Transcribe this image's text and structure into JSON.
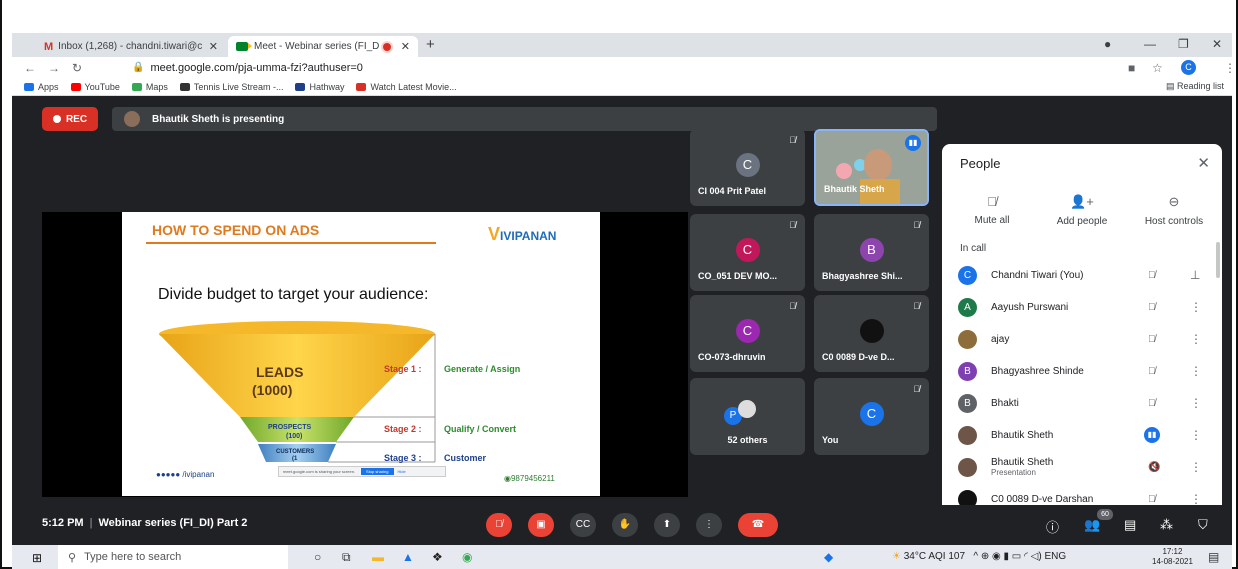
{
  "browser": {
    "tabs": [
      {
        "label": "Inbox (1,268) - chandni.tiwari@c"
      },
      {
        "label": "Meet - Webinar series (FI_D"
      }
    ],
    "url": "meet.google.com/pja-umma-fzi?authuser=0",
    "profile_initial": "C",
    "bookmarks": [
      "Apps",
      "YouTube",
      "Maps",
      "Tennis Live Stream -...",
      "Hathway",
      "Watch Latest Movie..."
    ],
    "reading_list": "Reading list"
  },
  "meet": {
    "rec_label": "REC",
    "presenting_text": "Bhautik Sheth is presenting",
    "slide": {
      "title": "HOW TO SPEND ON ADS",
      "logo": "IVIPANAN",
      "subhead": "Divide budget to target your audience:",
      "funnel": [
        {
          "name": "LEADS",
          "count": "(1000)",
          "stage": "Stage 1 :",
          "action": "Generate / Assign"
        },
        {
          "name": "PROSPECTS",
          "count": "(100)",
          "stage": "Stage 2 :",
          "action": "Qualify / Convert"
        },
        {
          "name": "CUSTOMERS",
          "count": "(1",
          "stage": "Stage 3 :",
          "action": "Customer"
        }
      ],
      "social": "/ivipanan",
      "phone": "9879456211",
      "share_notice": "meet.google.com is sharing your screen.",
      "share_stop": "Stop sharing",
      "share_hide": "Hide"
    },
    "tiles": [
      {
        "name": "CI 004 Prit Patel",
        "initial": "C",
        "color": "#6b7280"
      },
      {
        "name": "Bhautik Sheth",
        "initial": "",
        "color": ""
      },
      {
        "name": "CO_051 DEV MO...",
        "initial": "C",
        "color": "#c2185b"
      },
      {
        "name": "Bhagyashree Shi...",
        "initial": "B",
        "color": "#8e44ad"
      },
      {
        "name": "CO-073-dhruvin",
        "initial": "C",
        "color": "#9c27b0"
      },
      {
        "name": "C0 0089 D-ve D...",
        "initial": "",
        "color": "#111"
      },
      {
        "name": "52 others",
        "initial": "P",
        "color": "#1a73e8"
      },
      {
        "name": "You",
        "initial": "C",
        "color": "#1a73e8"
      }
    ],
    "people_panel": {
      "title": "People",
      "actions": [
        "Mute all",
        "Add people",
        "Host controls"
      ],
      "in_call": "In call",
      "participants": [
        {
          "name": "Chandni Tiwari (You)",
          "sub": "",
          "initial": "C",
          "color": "#1a73e8"
        },
        {
          "name": "Aayush Purswani",
          "sub": "",
          "initial": "A",
          "color": "#1e7a4a"
        },
        {
          "name": "ajay",
          "sub": "",
          "initial": "",
          "color": "#8d6e3a"
        },
        {
          "name": "Bhagyashree Shinde",
          "sub": "",
          "initial": "B",
          "color": "#7e3fb0"
        },
        {
          "name": "Bhakti",
          "sub": "",
          "initial": "B",
          "color": "#5f6368"
        },
        {
          "name": "Bhautik Sheth",
          "sub": "",
          "initial": "",
          "color": "#6d5547"
        },
        {
          "name": "Bhautik Sheth",
          "sub": "Presentation",
          "initial": "",
          "color": "#6d5547"
        },
        {
          "name": "C0 0089 D-ve Darshan",
          "sub": "",
          "initial": "",
          "color": "#111"
        }
      ]
    },
    "bottom": {
      "time": "5:12 PM",
      "meeting_name": "Webinar series (FI_DI) Part 2",
      "participant_count": "60"
    }
  },
  "taskbar": {
    "search_placeholder": "Type here to search",
    "weather": "34°C AQI 107",
    "lang": "ENG",
    "time": "17:12",
    "date": "14-08-2021"
  },
  "colors": {
    "meet_bg": "#202124",
    "tile_bg": "#3c4043",
    "accent_red": "#ea4335",
    "accent_blue": "#1a73e8"
  }
}
